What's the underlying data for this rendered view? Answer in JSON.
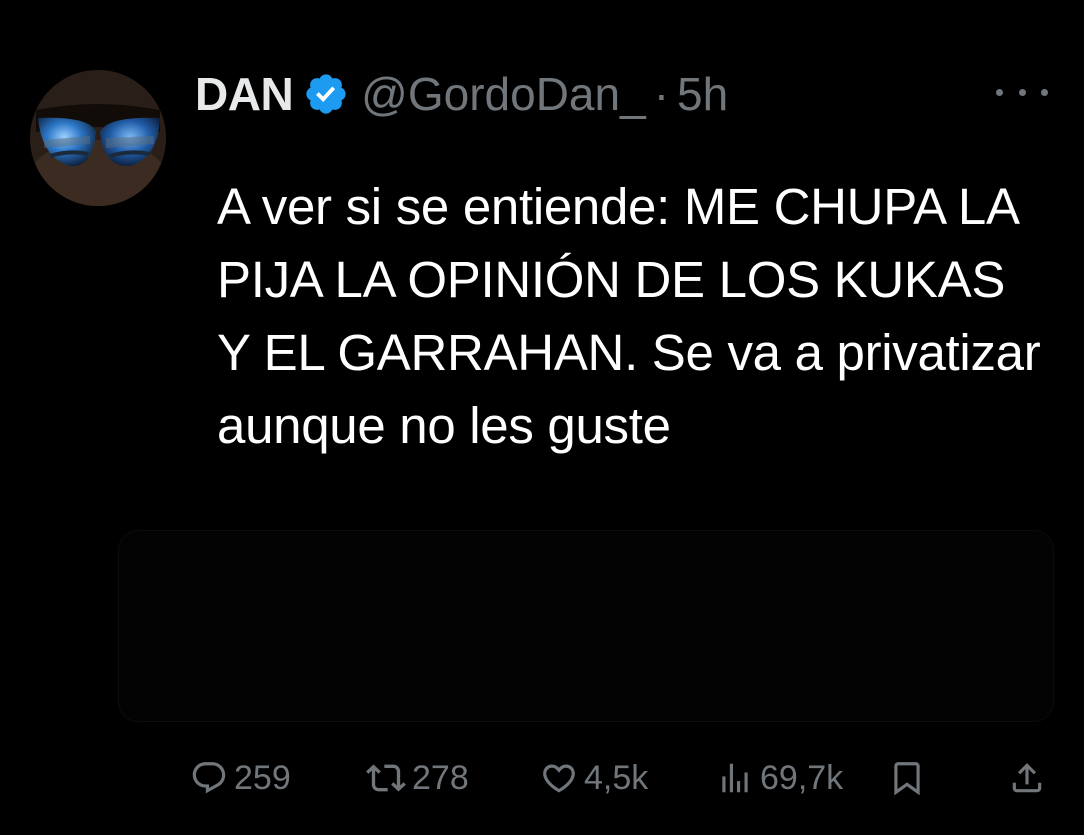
{
  "tweet": {
    "author": {
      "display_name": "DAN",
      "handle": "@GordoDan_",
      "verified": true
    },
    "separator": "·",
    "timestamp": "5h",
    "text": "A ver si se entiende: ME CHUPA LA PIJA LA OPINIÓN DE LOS KUKAS Y EL GARRAHAN. Se va a privatizar aunque no les guste",
    "actions": {
      "replies": "259",
      "reposts": "278",
      "likes": "4,5k",
      "views": "69,7k"
    },
    "icons": {
      "verified": "verified-badge-icon",
      "more": "more-dots-icon",
      "reply": "reply-bubble-icon",
      "repost": "repost-arrows-icon",
      "like": "heart-icon",
      "views": "bar-chart-icon",
      "bookmark": "bookmark-icon",
      "share": "share-upload-icon"
    }
  },
  "colors": {
    "background": "#000000",
    "primary_text": "#e7e9ea",
    "secondary_text": "#71767b",
    "verified_blue": "#1d9bf0"
  }
}
